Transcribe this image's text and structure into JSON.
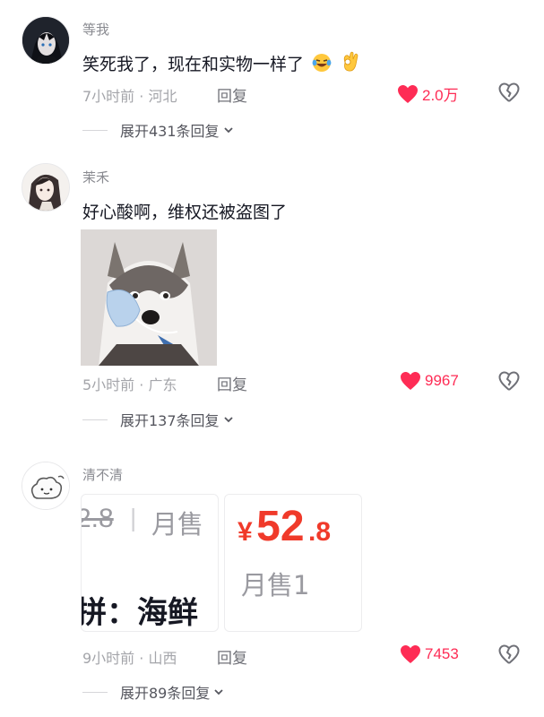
{
  "comments": [
    {
      "username": "等我",
      "text": "笑死我了，现在和实物一样了",
      "time_location": "7小时前 · 河北",
      "reply_label": "回复",
      "likes": "2.0万",
      "expand_label": "展开431条回复",
      "avatar_icon": "dark-anime-boy-avatar"
    },
    {
      "username": "茉禾",
      "text": "好心酸啊，维权还被盗图了",
      "time_location": "5小时前 · 广东",
      "reply_label": "回复",
      "likes": "9967",
      "expand_label": "展开137条回复",
      "avatar_icon": "anime-girl-avatar",
      "image_icon": "husky-with-mask-photo"
    },
    {
      "username": "清不清",
      "time_location": "9小时前 · 山西",
      "reply_label": "回复",
      "likes": "7453",
      "expand_label": "展开89条回复",
      "avatar_icon": "cartoon-cloud-avatar",
      "screenshot1": {
        "price_partial": "2.8",
        "divider": "|",
        "sales_partial": "月售",
        "title_partial": "拼：海鲜"
      },
      "screenshot2": {
        "currency": "¥",
        "price_main": "52",
        "price_decimal": ".8",
        "sales": "月售1"
      }
    }
  ],
  "colors": {
    "like": "#fe2c55",
    "price": "#f03a2a",
    "meta": "#a4a5aa"
  }
}
